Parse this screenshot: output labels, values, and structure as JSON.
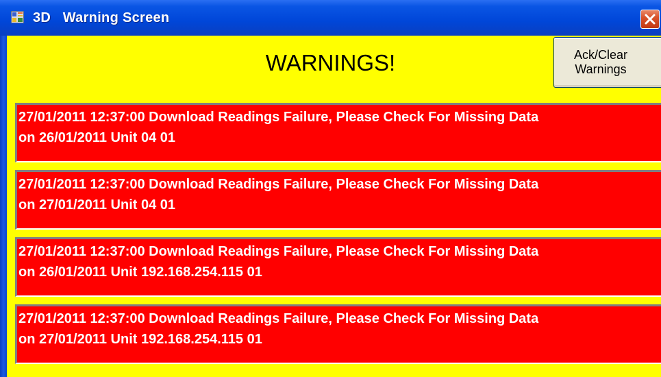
{
  "window": {
    "title": "3D   Warning Screen",
    "title_icon": "app-window-icon",
    "close_icon": "close-icon",
    "titlebar_color": "#0046d8",
    "client_color": "#ffff00"
  },
  "header": {
    "heading": "WARNINGS!",
    "ack_button": {
      "line1": "Ack/Clear",
      "line2": "Warnings"
    }
  },
  "warnings": [
    {
      "line1": "27/01/2011 12:37:00 Download Readings Failure, Please Check For Missing Data",
      "line2": "on 26/01/2011 Unit 04 01"
    },
    {
      "line1": "27/01/2011 12:37:00 Download Readings Failure, Please Check For Missing Data",
      "line2": "on 27/01/2011 Unit 04 01"
    },
    {
      "line1": "27/01/2011 12:37:00 Download Readings Failure, Please Check For Missing Data",
      "line2": "on 26/01/2011 Unit 192.168.254.115 01"
    },
    {
      "line1": "27/01/2011 12:37:00 Download Readings Failure, Please Check For Missing Data",
      "line2": "on 27/01/2011 Unit 192.168.254.115 01"
    }
  ],
  "colors": {
    "warning_background": "#ff0000",
    "warning_text": "#ffffff"
  }
}
